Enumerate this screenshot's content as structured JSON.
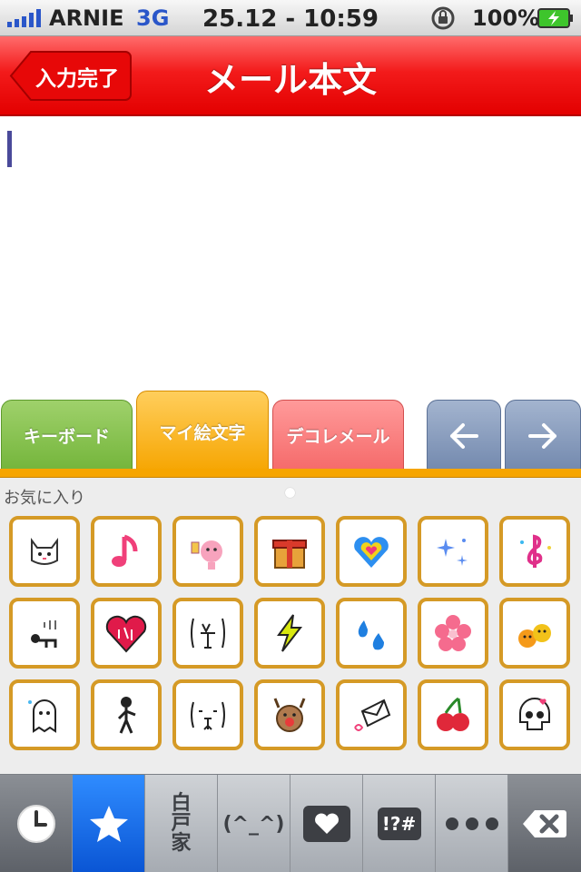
{
  "status_bar": {
    "carrier": "ARNIE",
    "network": "3G",
    "datetime": "25.12 - 10:59",
    "battery_text": "100%",
    "icons": [
      "signal-icon",
      "rotation-lock-icon",
      "battery-charging-icon"
    ]
  },
  "nav": {
    "back_label": "入力完了",
    "title": "メール本文",
    "color": "#f31b1b"
  },
  "tabs": {
    "keyboard": "キーボード",
    "my_emoji": "マイ絵文字",
    "deco_mail": "デコレメール",
    "prev_icon": "left-arrow-icon",
    "next_icon": "right-arrow-icon"
  },
  "palette": {
    "label": "お気に入り",
    "emoji": [
      "cat-face-icon",
      "music-note-icon",
      "pink-pig-toast-icon",
      "gift-box-icon",
      "rainbow-heart-icon",
      "sparkles-icon",
      "treble-clef-icon",
      "depressed-person-icon",
      "orikare-heart-icon",
      "kaomoji-panic-icon",
      "lightning-bolt-icon",
      "water-drops-icon",
      "pink-flower-icon",
      "orange-faces-icon",
      "ghost-icon",
      "stick-figure-icon",
      "kaomoji-sad-icon",
      "reindeer-face-icon",
      "love-letter-icon",
      "cherries-icon",
      "skull-heart-icon"
    ]
  },
  "toolbar": {
    "home_label_1": "白",
    "home_label_2": "戸",
    "home_label_3": "家",
    "kaomoji_label": "(^_^)",
    "symbol_label": "!?#",
    "icons": [
      "clock-icon",
      "star-icon",
      "heart-key-icon",
      "more-icon",
      "delete-icon"
    ]
  }
}
